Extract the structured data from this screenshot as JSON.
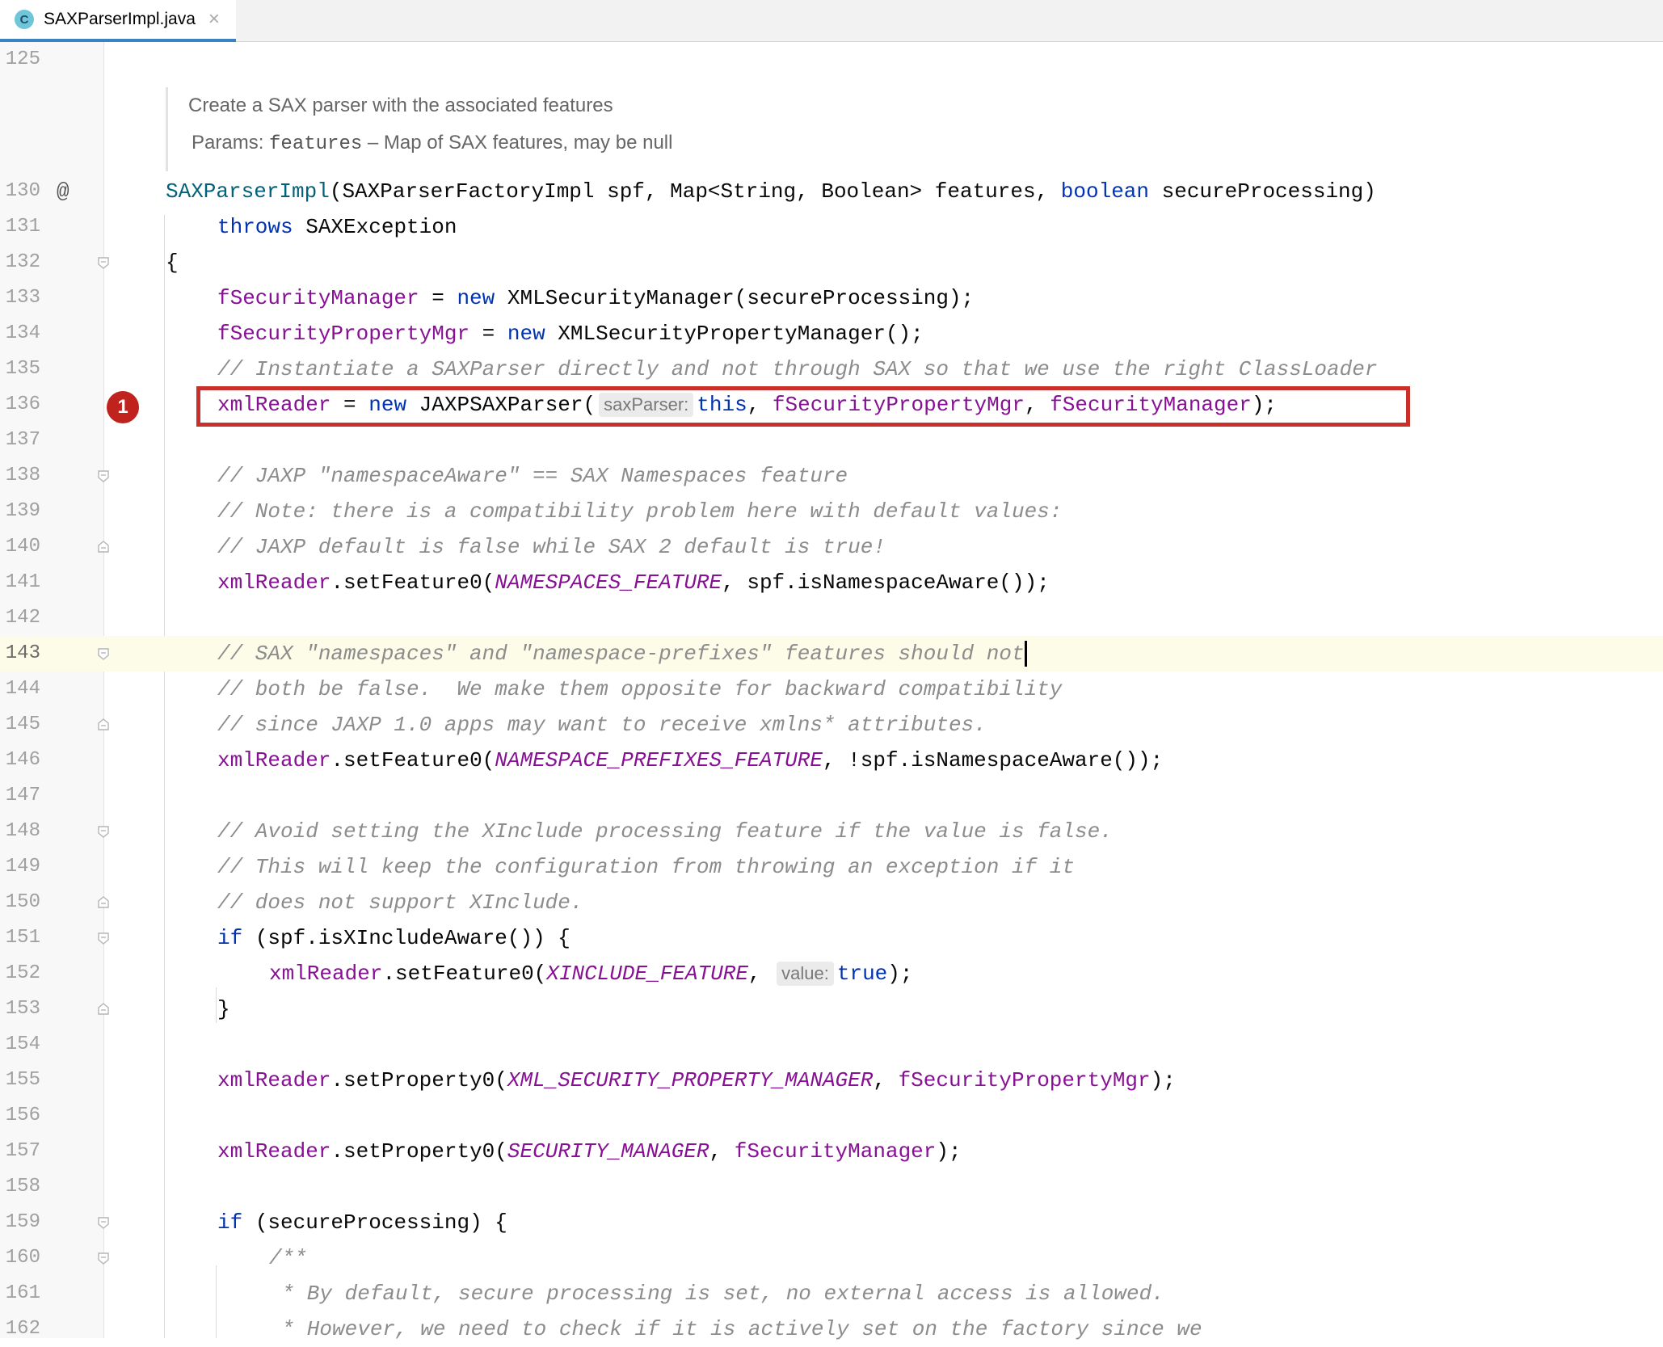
{
  "tab": {
    "file_name": "SAXParserImpl.java",
    "icon_letter": "C",
    "close_glyph": "×"
  },
  "doc_comment": {
    "summary": "Create a SAX parser with the associated features",
    "params_label": "Params:",
    "param_name": "features",
    "param_desc": " – Map of SAX features, may be null"
  },
  "gutter": {
    "override_marker": "@",
    "breakpoint_label": "1"
  },
  "lines": [
    {
      "num": "125"
    },
    {
      "num": "130",
      "t1": "SAXParserImpl",
      "t2": "(SAXParserFactoryImpl spf, Map<String, Boolean> features, ",
      "t3": "boolean",
      "t4": " secureProcessing)"
    },
    {
      "num": "131",
      "t1": "throws",
      "t2": " SAXException"
    },
    {
      "num": "132",
      "t1": "{"
    },
    {
      "num": "133",
      "t1": "fSecurityManager",
      "t2": " = ",
      "t3": "new",
      "t4": " XMLSecurityManager(secureProcessing);"
    },
    {
      "num": "134",
      "t1": "fSecurityPropertyMgr",
      "t2": " = ",
      "t3": "new",
      "t4": " XMLSecurityPropertyManager();"
    },
    {
      "num": "135",
      "t1": "// Instantiate a SAXParser directly and not through SAX so that we use the right ClassLoader"
    },
    {
      "num": "136",
      "t1": "xmlReader",
      "t2": " = ",
      "t3": "new",
      "t4": " JAXPSAXParser(",
      "hint": "saxParser:",
      "t5": "this",
      "t6": ", ",
      "t7": "fSecurityPropertyMgr",
      "t8": ", ",
      "t9": "fSecurityManager",
      "t10": ");"
    },
    {
      "num": "137"
    },
    {
      "num": "138",
      "t1": "// JAXP \"namespaceAware\" == SAX Namespaces feature"
    },
    {
      "num": "139",
      "t1": "// Note: there is a compatibility problem here with default values:"
    },
    {
      "num": "140",
      "t1": "// JAXP default is false while SAX 2 default is true!"
    },
    {
      "num": "141",
      "t1": "xmlReader",
      "t2": ".setFeature0(",
      "t3": "NAMESPACES_FEATURE",
      "t4": ", spf.isNamespaceAware());"
    },
    {
      "num": "142"
    },
    {
      "num": "143",
      "t1": "// SAX \"namespaces\" and \"namespace-prefixes\" features should not"
    },
    {
      "num": "144",
      "t1": "// both be false.  We make them opposite for backward compatibility"
    },
    {
      "num": "145",
      "t1": "// since JAXP 1.0 apps may want to receive xmlns* attributes."
    },
    {
      "num": "146",
      "t1": "xmlReader",
      "t2": ".setFeature0(",
      "t3": "NAMESPACE_PREFIXES_FEATURE",
      "t4": ", !spf.isNamespaceAware());"
    },
    {
      "num": "147"
    },
    {
      "num": "148",
      "t1": "// Avoid setting the XInclude processing feature if the value is false."
    },
    {
      "num": "149",
      "t1": "// This will keep the configuration from throwing an exception if it"
    },
    {
      "num": "150",
      "t1": "// does not support XInclude."
    },
    {
      "num": "151",
      "t1": "if",
      "t2": " (spf.isXIncludeAware()) {"
    },
    {
      "num": "152",
      "t1": "xmlReader",
      "t2": ".setFeature0(",
      "t3": "XINCLUDE_FEATURE",
      "t4": ", ",
      "hint": "value:",
      "t5": "true",
      "t6": ");"
    },
    {
      "num": "153",
      "t1": "}"
    },
    {
      "num": "154"
    },
    {
      "num": "155",
      "t1": "xmlReader",
      "t2": ".setProperty0(",
      "t3": "XML_SECURITY_PROPERTY_MANAGER",
      "t4": ", ",
      "t5": "fSecurityPropertyMgr",
      "t6": ");"
    },
    {
      "num": "156"
    },
    {
      "num": "157",
      "t1": "xmlReader",
      "t2": ".setProperty0(",
      "t3": "SECURITY_MANAGER",
      "t4": ", ",
      "t5": "fSecurityManager",
      "t6": ");"
    },
    {
      "num": "158"
    },
    {
      "num": "159",
      "t1": "if",
      "t2": " (secureProcessing) {"
    },
    {
      "num": "160",
      "t1": "/**"
    },
    {
      "num": "161",
      "t1": " * By default, secure processing is set, no external access is allowed."
    },
    {
      "num": "162",
      "t1": " * However, we need to check if it is actively set on the factory since we"
    }
  ],
  "colors": {
    "keyword": "#0033b3",
    "field": "#871094",
    "comment": "#8c8c8c",
    "declaration": "#00627a",
    "highlight_box": "#c9302c",
    "current_line": "#fdfce8",
    "tab_underline": "#3b82c4"
  }
}
